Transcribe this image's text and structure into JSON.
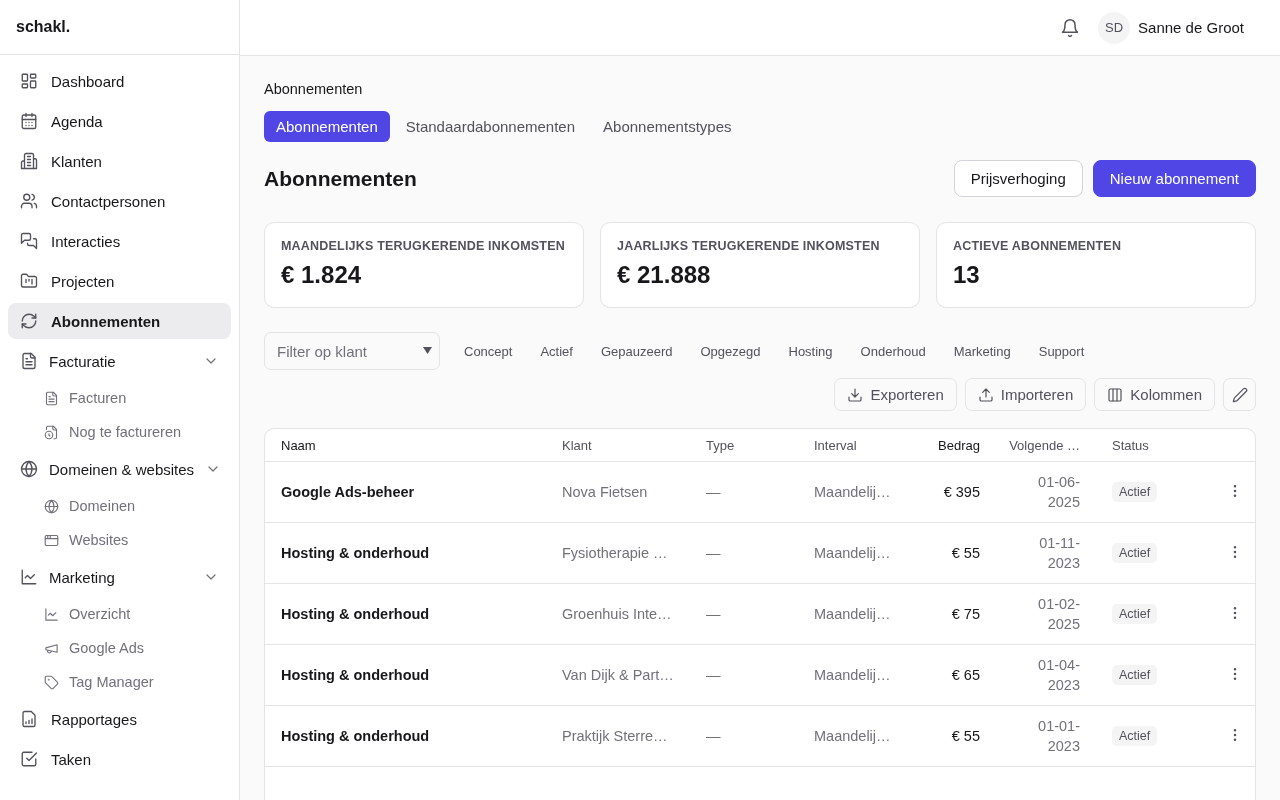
{
  "brand": "schakl.",
  "sidebar": {
    "items": [
      {
        "label": "Dashboard",
        "selected": false
      },
      {
        "label": "Agenda",
        "selected": false
      },
      {
        "label": "Klanten",
        "selected": false
      },
      {
        "label": "Contactpersonen",
        "selected": false
      },
      {
        "label": "Interacties",
        "selected": false
      },
      {
        "label": "Projecten",
        "selected": false
      },
      {
        "label": "Abonnementen",
        "selected": true
      },
      {
        "label": "Facturatie",
        "selected": false,
        "expanded": true,
        "children": [
          {
            "label": "Facturen",
            "selected": false
          },
          {
            "label": "Nog te factureren",
            "selected": false
          }
        ]
      },
      {
        "label": "Domeinen & websites",
        "selected": false,
        "expanded": true,
        "children": [
          {
            "label": "Domeinen",
            "selected": false
          },
          {
            "label": "Websites",
            "selected": false
          }
        ]
      },
      {
        "label": "Marketing",
        "selected": false,
        "expanded": true,
        "children": [
          {
            "label": "Overzicht",
            "selected": false
          },
          {
            "label": "Google Ads",
            "selected": false
          },
          {
            "label": "Tag Manager",
            "selected": false
          }
        ]
      },
      {
        "label": "Rapportages",
        "selected": false
      },
      {
        "label": "Taken",
        "selected": false
      }
    ]
  },
  "user": {
    "initials": "SD",
    "name": "Sanne de Groot"
  },
  "breadcrumb": "Abonnementen",
  "tabs": [
    {
      "label": "Abonnementen",
      "selected": true
    },
    {
      "label": "Standaardabonnementen",
      "selected": false
    },
    {
      "label": "Abonnementstypes",
      "selected": false
    }
  ],
  "title": "Abonnementen",
  "actions": [
    {
      "label": "Prijsverhoging",
      "kind": "secondary"
    },
    {
      "label": "Nieuw abonnement",
      "kind": "primary"
    }
  ],
  "stats": [
    {
      "label": "MAANDELIJKS TERUGKERENDE INKOMSTEN",
      "value": "€ 1.824"
    },
    {
      "label": "JAARLIJKS TERUGKERENDE INKOMSTEN",
      "value": "€ 21.888"
    },
    {
      "label": "ACTIEVE ABONNEMENTEN",
      "value": "13"
    }
  ],
  "filter": {
    "placeholder": "Filter op klant"
  },
  "chips": [
    "Concept",
    "Actief",
    "Gepauzeerd",
    "Opgezegd",
    "Hosting",
    "Onderhoud",
    "Marketing",
    "Support"
  ],
  "tools": [
    {
      "label": "Exporteren",
      "kind": "download"
    },
    {
      "label": "Importeren",
      "kind": "upload"
    },
    {
      "label": "Kolommen",
      "kind": "columns"
    },
    {
      "kind": "edit"
    }
  ],
  "table": {
    "columns": [
      "Naam",
      "Klant",
      "Type",
      "Interval",
      "Bedrag",
      "Volgende …",
      "Status"
    ],
    "rows": [
      [
        "Google Ads-beheer",
        "Nova Fietsen",
        "—",
        "Maandelij…",
        "€ 395",
        "01-06-2025",
        "Actief"
      ],
      [
        "Hosting & onderhoud",
        "Fysiotherapie …",
        "—",
        "Maandelij…",
        "€ 55",
        "01-11-2023",
        "Actief"
      ],
      [
        "Hosting & onderhoud",
        "Groenhuis Inte…",
        "—",
        "Maandelij…",
        "€ 75",
        "01-02-2025",
        "Actief"
      ],
      [
        "Hosting & onderhoud",
        "Van Dijk & Part…",
        "—",
        "Maandelij…",
        "€ 65",
        "01-04-2023",
        "Actief"
      ],
      [
        "Hosting & onderhoud",
        "Praktijk Sterre…",
        "—",
        "Maandelij…",
        "€ 55",
        "01-01-2023",
        "Actief"
      ]
    ]
  }
}
